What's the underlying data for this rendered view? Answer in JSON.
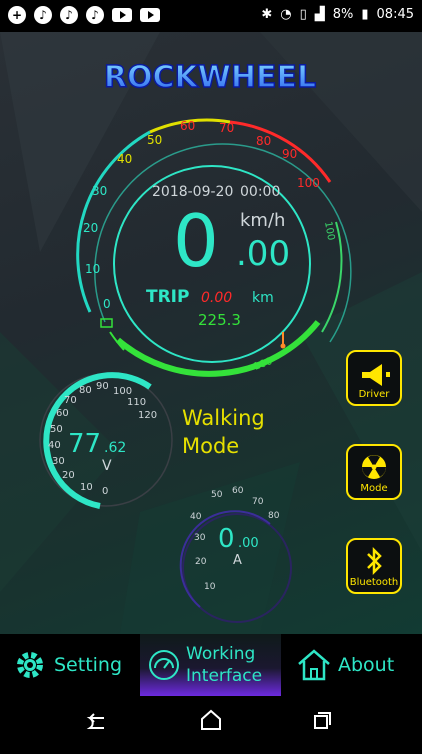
{
  "status": {
    "battery": "8%",
    "time": "08:45"
  },
  "logo": "ROCKWHEEL",
  "speedo": {
    "date": "2018-09-20",
    "clock": "00:00",
    "speed_int": "0",
    "speed_dec": ".00",
    "unit": "km/h",
    "trip_label": "TRIP",
    "trip_value": "0.00",
    "trip_unit": "km",
    "odometer": "225.3",
    "scale": [
      "0",
      "10",
      "20",
      "30",
      "40",
      "50",
      "60",
      "70",
      "80",
      "90",
      "100"
    ],
    "battery_scale": "100",
    "temp_scale": "100"
  },
  "voltage": {
    "value_int": "77",
    "value_dec": ".62",
    "unit": "V",
    "scale": [
      "0",
      "10",
      "20",
      "30",
      "40",
      "50",
      "60",
      "70",
      "80",
      "90",
      "100",
      "110",
      "120"
    ]
  },
  "current": {
    "value_int": "0",
    "value_dec": ".00",
    "unit": "A",
    "scale": [
      "10",
      "20",
      "30",
      "40",
      "50",
      "60",
      "70",
      "80"
    ]
  },
  "mode_text": {
    "line1": "Walking",
    "line2": "Mode"
  },
  "side_buttons": {
    "driver": "Driver",
    "mode": "Mode",
    "bluetooth": "Bluetooth"
  },
  "nav": {
    "setting": "Setting",
    "working_line1": "Working",
    "working_line2": "Interface",
    "about": "About"
  },
  "colors": {
    "accent": "#2ee6c6",
    "yellow": "#ffe600",
    "red": "#ff2a2a",
    "green": "#34e23a"
  }
}
